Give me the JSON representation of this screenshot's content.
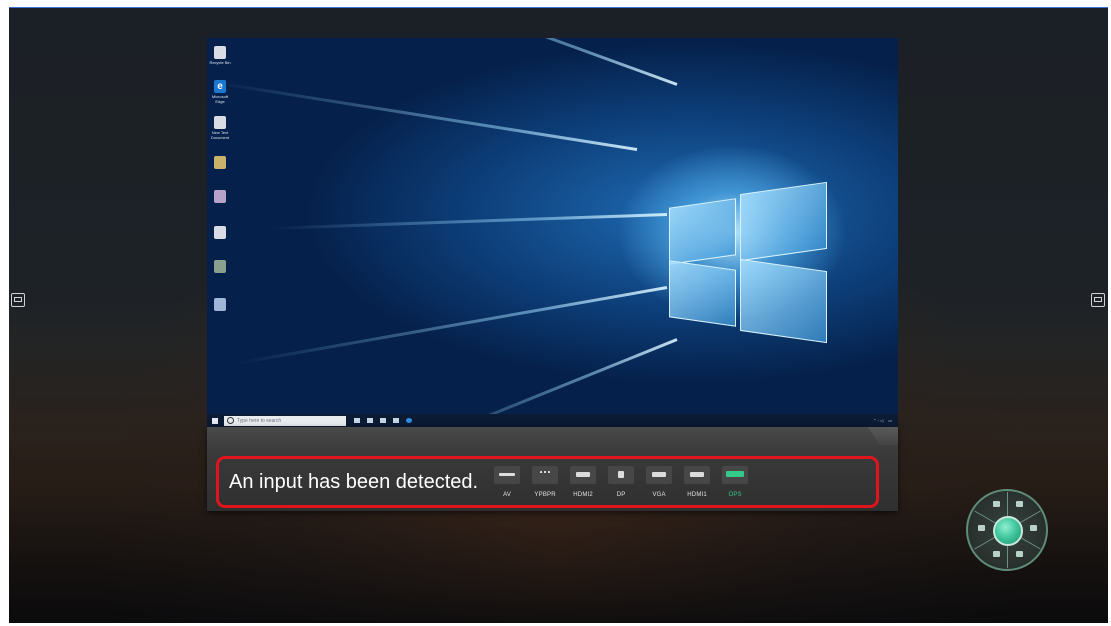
{
  "detection": {
    "message": "An input has been detected.",
    "sources": [
      {
        "label": "AV",
        "icon": "av-port-icon",
        "active": false
      },
      {
        "label": "YPBPR",
        "icon": "ypbpr-port-icon",
        "active": false
      },
      {
        "label": "HDMI2",
        "icon": "hdmi-port-icon",
        "active": false
      },
      {
        "label": "DP",
        "icon": "displayport-icon",
        "active": false
      },
      {
        "label": "VGA",
        "icon": "vga-port-icon",
        "active": false
      },
      {
        "label": "HDMI1",
        "icon": "hdmi-port-icon",
        "active": false
      },
      {
        "label": "OPS",
        "icon": "ops-icon",
        "active": true
      }
    ]
  },
  "desktop": {
    "icons": [
      {
        "label": "Recycle Bin",
        "icon": "recycle-bin-icon"
      },
      {
        "label": "Microsoft Edge",
        "icon": "edge-icon"
      },
      {
        "label": "New Text Document",
        "icon": "text-document-icon"
      },
      {
        "label": "",
        "icon": "app-icon"
      },
      {
        "label": "",
        "icon": "app-icon"
      },
      {
        "label": "",
        "icon": "app-icon"
      },
      {
        "label": "",
        "icon": "app-icon"
      },
      {
        "label": "",
        "icon": "file-icon"
      }
    ],
    "taskbar": {
      "search_placeholder": "Type here to search"
    }
  },
  "colors": {
    "highlight_border": "#e0141c",
    "active_source": "#34c88a",
    "menu_accent": "#3cc39a"
  }
}
